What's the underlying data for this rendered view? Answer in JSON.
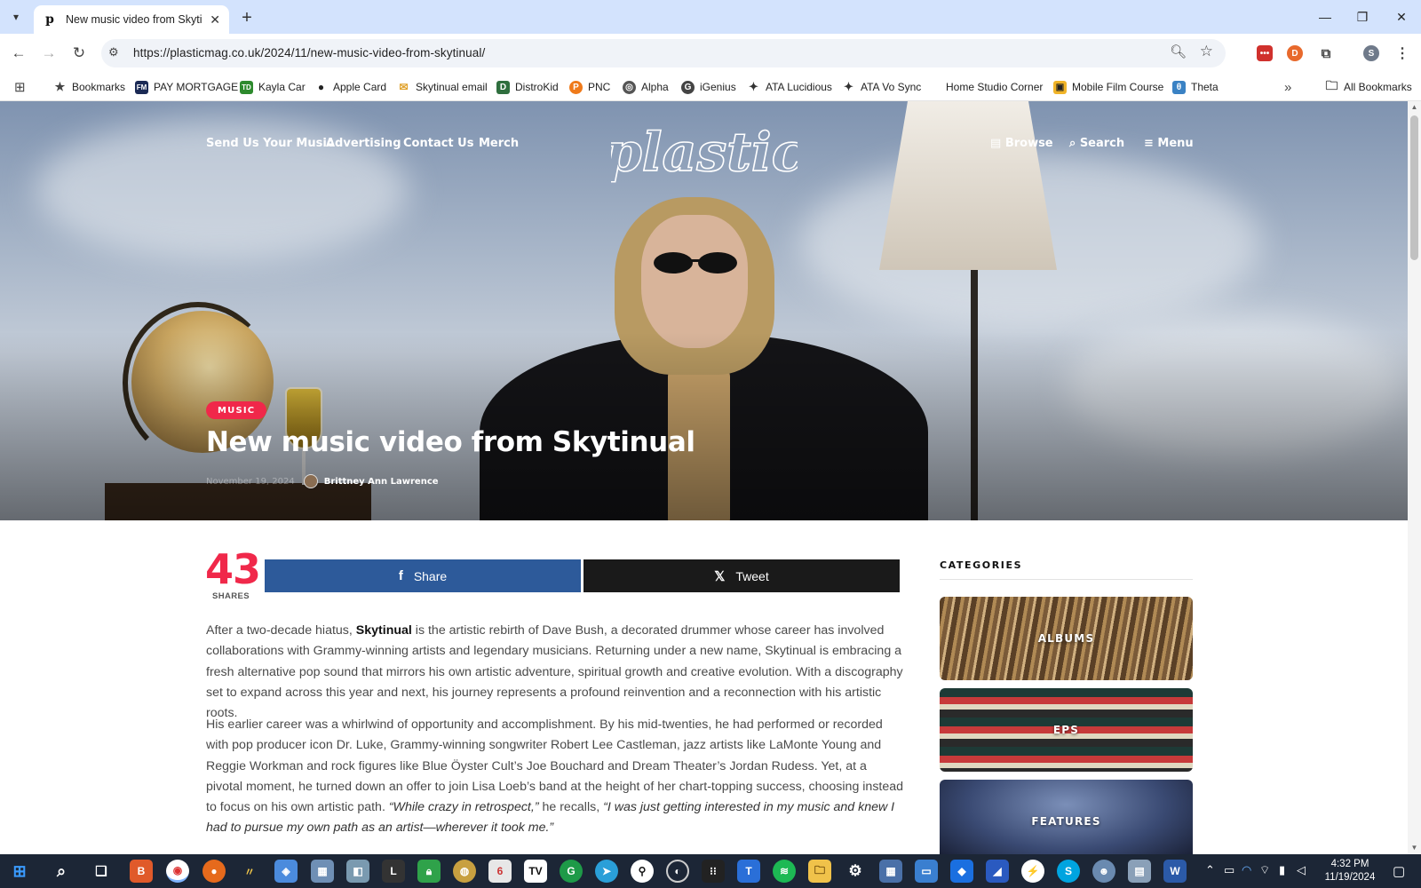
{
  "browser": {
    "tab_title": "New music video from Skytinual",
    "url": "https://plasticmag.co.uk/2024/11/new-music-video-from-skytinual/",
    "profile_initial": "S"
  },
  "bookmarks": {
    "items": [
      "Bookmarks",
      "PAY MORTGAGE",
      "Kayla Car",
      "Apple Card",
      "Skytinual email",
      "DistroKid",
      "PNC",
      "Alpha",
      "iGenius",
      "ATA Lucidious",
      "ATA Vo Sync",
      "Home Studio Corner",
      "Mobile Film Course",
      "Theta"
    ],
    "all_label": "All Bookmarks"
  },
  "site": {
    "nav_left": [
      "Send Us Your Music",
      "Advertising",
      "Contact Us",
      "Merch"
    ],
    "logo_text": "plastic",
    "nav_right": [
      "Browse",
      "Search",
      "Menu"
    ]
  },
  "post": {
    "category": "MUSIC",
    "title": "New music video from Skytinual",
    "date": "November 19, 2024",
    "author": "Brittney Ann Lawrence"
  },
  "share": {
    "count": "43",
    "count_label": "SHARES",
    "share_label": "Share",
    "tweet_label": "Tweet"
  },
  "article": {
    "p1_a": "After a two-decade hiatus, ",
    "p1_b": "Skytinual",
    "p1_c": " is the artistic rebirth of Dave Bush, a decorated drummer whose career has involved collaborations with Grammy-winning artists and legendary musicians. Returning under a new name, Skytinual is embracing a fresh alternative pop sound that mirrors his own artistic adventure, spiritual growth and creative evolution. With a discography set to expand across this year and next, his journey represents a profound reinvention and a reconnection with his artistic roots.",
    "p2_a": "His earlier career was a whirlwind of opportunity and accomplishment. By his mid-twenties, he had performed or recorded with pop producer icon Dr. Luke, Grammy-winning songwriter Robert Lee Castleman, jazz artists like LaMonte Young and Reggie Workman and rock figures like Blue Öyster Cult’s Joe Bouchard and Dream Theater’s Jordan Rudess. Yet, at a pivotal moment, he turned down an offer to join Lisa Loeb’s band at the height of her chart-topping success, choosing instead to focus on his own artistic path. ",
    "p2_q1": "“While crazy in retrospect,”",
    "p2_b": " he recalls, ",
    "p2_q2": "“I was just getting interested in my music and knew I had to pursue my own path as an artist—wherever it took me.”"
  },
  "sidebar": {
    "heading": "CATEGORIES",
    "categories": [
      "ALBUMS",
      "EPS",
      "FEATURES"
    ]
  },
  "taskbar": {
    "time": "4:32 PM",
    "date": "11/19/2024"
  },
  "colors": {
    "accent": "#f0284a",
    "facebook": "#2d5a9a",
    "x": "#1a1a1a",
    "tabstrip": "#d3e3fd",
    "taskbar": "#1c2636"
  }
}
